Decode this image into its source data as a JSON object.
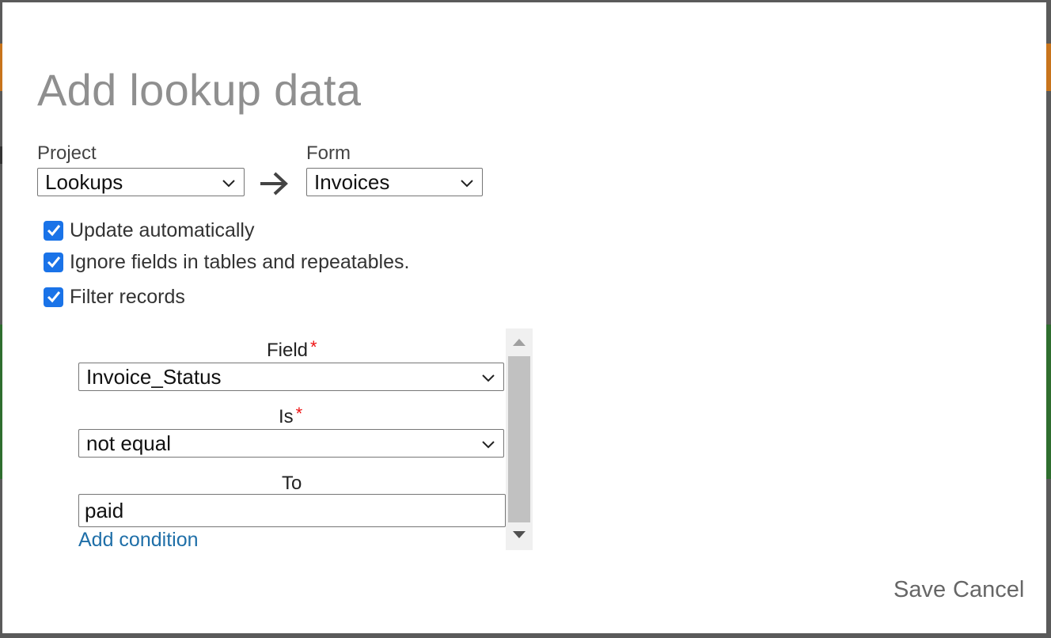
{
  "dialog": {
    "title": "Add lookup data",
    "project": {
      "label": "Project",
      "selected": "Lookups"
    },
    "form": {
      "label": "Form",
      "selected": "Invoices"
    },
    "checkboxes": [
      {
        "label": "Update automatically",
        "checked": true
      },
      {
        "label": "Ignore fields in tables and repeatables.",
        "checked": true
      },
      {
        "label": "Filter records",
        "checked": true
      }
    ],
    "filter": {
      "field": {
        "label": "Field",
        "required_mark": "*",
        "selected": "Invoice_Status"
      },
      "is": {
        "label": "Is",
        "required_mark": "*",
        "selected": "not equal"
      },
      "to": {
        "label": "To",
        "value": "paid"
      },
      "add_condition": "Add condition"
    },
    "actions": {
      "save": "Save",
      "cancel": "Cancel"
    }
  },
  "colors": {
    "checkbox": "#1a73e8",
    "link": "#1f6fa8",
    "required": "#ee1111",
    "title": "#8f8f8f"
  }
}
